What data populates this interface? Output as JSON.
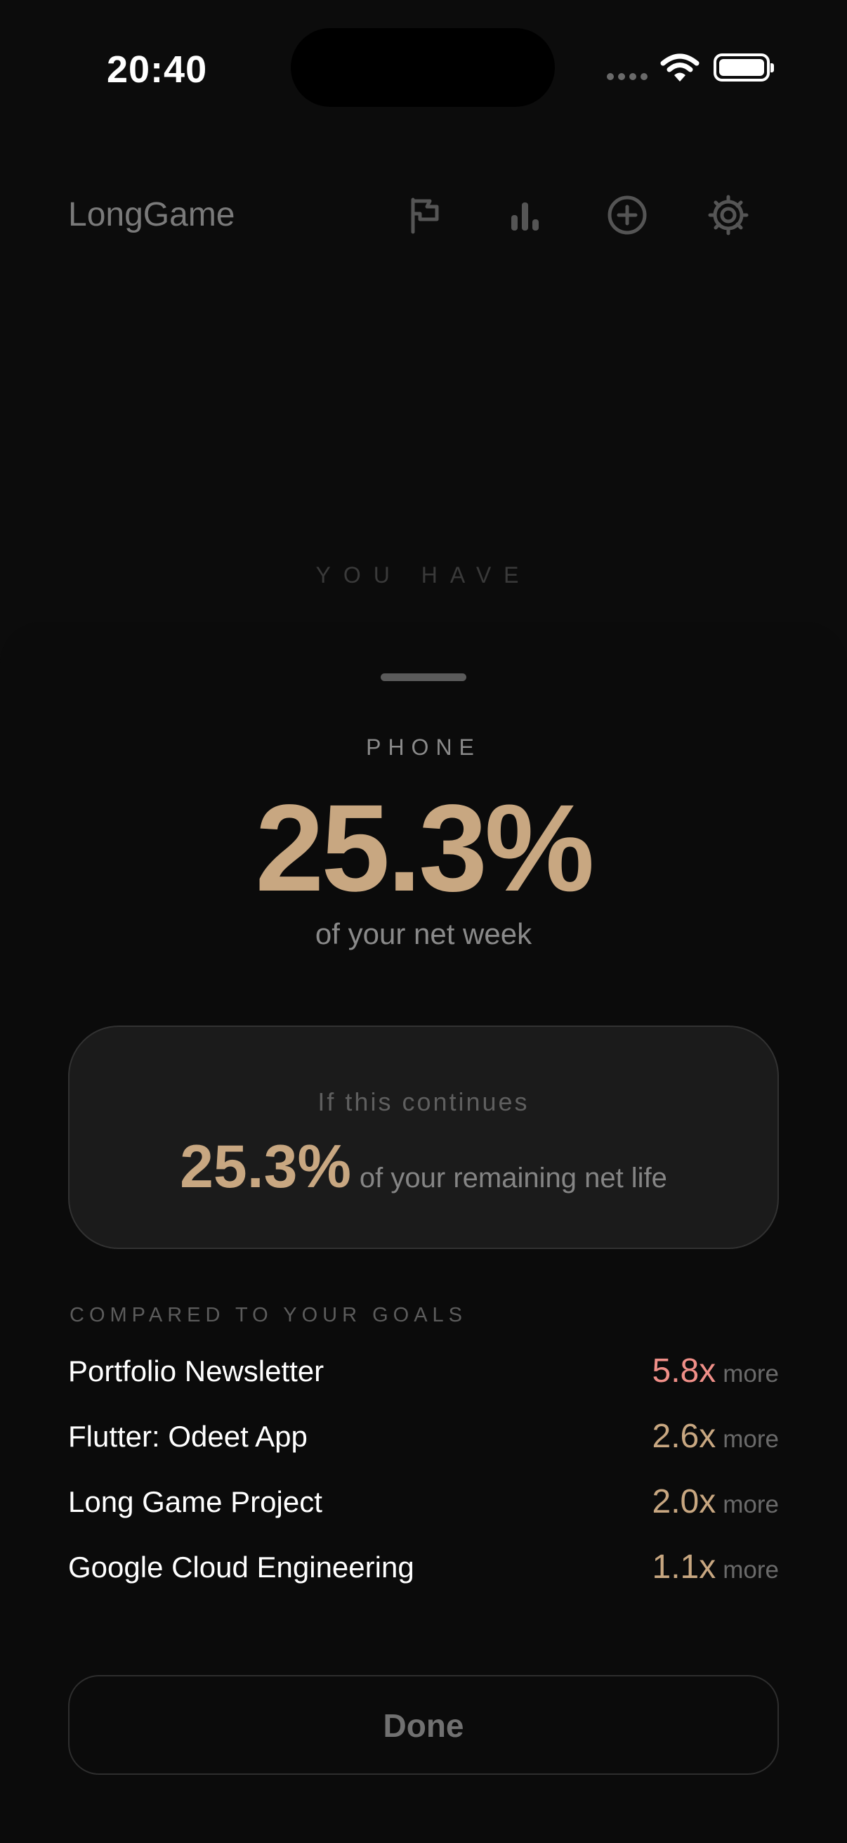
{
  "status_bar": {
    "time": "20:40"
  },
  "header": {
    "app_title": "LongGame",
    "icons": [
      "flag-icon",
      "bar-chart-icon",
      "add-circle-icon",
      "gear-icon"
    ]
  },
  "background_label": "YOU HAVE",
  "sheet": {
    "category": "PHONE",
    "percentage": "25.3%",
    "percentage_caption": "of your net week",
    "projection": {
      "label": "If this continues",
      "value": "25.3%",
      "text": "of your remaining net life"
    },
    "goals_header": "COMPARED TO YOUR GOALS",
    "goals": [
      {
        "name": "Portfolio Newsletter",
        "multiplier": "5.8x",
        "suffix": "more",
        "color": "#f08f88"
      },
      {
        "name": "Flutter: Odeet App",
        "multiplier": "2.6x",
        "suffix": "more",
        "color": "#c8a781"
      },
      {
        "name": "Long Game Project",
        "multiplier": "2.0x",
        "suffix": "more",
        "color": "#c8a781"
      },
      {
        "name": "Google Cloud Engineering",
        "multiplier": "1.1x",
        "suffix": "more",
        "color": "#c8a781"
      }
    ],
    "done_label": "Done"
  },
  "colors": {
    "accent": "#c8a781",
    "alert": "#f08f88",
    "background": "#0c0c0c"
  }
}
